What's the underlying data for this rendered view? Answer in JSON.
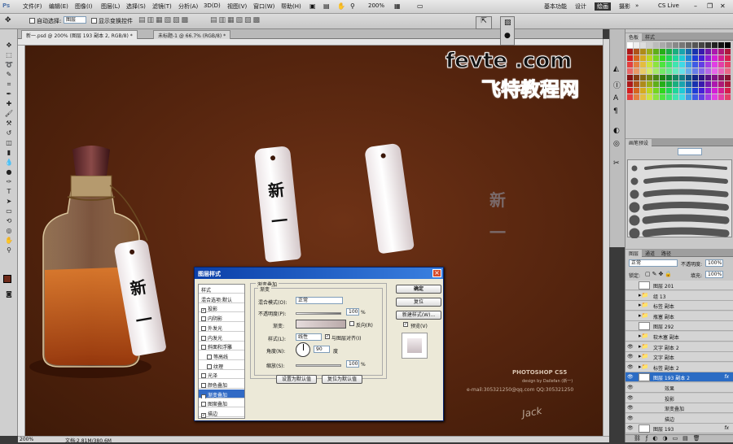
{
  "menu": {
    "logo": "Ps",
    "items": [
      "文件(F)",
      "编辑(E)",
      "图像(I)",
      "图层(L)",
      "选择(S)",
      "滤镜(T)",
      "分析(A)",
      "3D(D)",
      "视图(V)",
      "窗口(W)",
      "帮助(H)"
    ],
    "zoom": "200%",
    "workspace": [
      "基本功能",
      "设计",
      "绘画",
      "摄影"
    ],
    "workspace_active": "绘画",
    "cslive": "CS Live"
  },
  "options": {
    "autoselect": "自动选择:",
    "autoselect_value": "图层",
    "show_transform": "显示变换控件"
  },
  "tabs": [
    {
      "label": "新一.psd @ 200% (图层 193 副本 2, RGB/8) *"
    },
    {
      "label": "未标题-1 @ 66.7% (RGB/8) *"
    }
  ],
  "watermark": {
    "line1": "fevte .com",
    "line2": "飞特教程网"
  },
  "canvas": {
    "tag_char1": "新",
    "tag_char2": "一",
    "credit_title": "PHOTOSHOP CS5",
    "credit_sub": "design by Dailefan (新一)",
    "email": "e-mail:305321250@qq.com  QQ:305321250",
    "signature": "Jack"
  },
  "status": {
    "zoom": "200%",
    "doc": "文档:2.81M/380.6M"
  },
  "panels": {
    "swatches_tabs": [
      "色板",
      "样式"
    ],
    "brush_tab": "画笔预设",
    "layers_tabs": [
      "图层",
      "通道",
      "路径"
    ],
    "blend_mode": "正常",
    "opacity_label": "不透明度:",
    "opacity": "100%",
    "lock_label": "锁定:",
    "fill_label": "填充:",
    "fill": "100%",
    "layers": [
      {
        "name": "图层 201",
        "type": "layer",
        "eye": false
      },
      {
        "name": "组 13",
        "type": "group",
        "eye": false
      },
      {
        "name": "标签 副本",
        "type": "group",
        "eye": false
      },
      {
        "name": "瓶塞 副本",
        "type": "group",
        "eye": false
      },
      {
        "name": "图层 292",
        "type": "layer",
        "eye": false
      },
      {
        "name": "软木塞 副本",
        "type": "group",
        "eye": false
      },
      {
        "name": "文字 副本 2",
        "type": "group",
        "eye": true
      },
      {
        "name": "文字 副本",
        "type": "group",
        "eye": true
      },
      {
        "name": "标签 副本 2",
        "type": "group",
        "eye": true
      },
      {
        "name": "图层 193 副本 2",
        "type": "layer",
        "eye": true,
        "selected": true,
        "fx": "fx"
      },
      {
        "name": "效果",
        "type": "effect",
        "eye": true
      },
      {
        "name": "投影",
        "type": "effect",
        "eye": true
      },
      {
        "name": "渐变叠加",
        "type": "effect",
        "eye": true
      },
      {
        "name": "描边",
        "type": "effect",
        "eye": true
      },
      {
        "name": "图层 193",
        "type": "layer",
        "eye": true,
        "fx": "fx"
      }
    ]
  },
  "dialog": {
    "title": "图层样式",
    "styles": [
      {
        "label": "样式",
        "cb": null
      },
      {
        "label": "混合选项:默认",
        "cb": null
      },
      {
        "label": "投影",
        "cb": true
      },
      {
        "label": "内阴影",
        "cb": false
      },
      {
        "label": "外发光",
        "cb": false
      },
      {
        "label": "内发光",
        "cb": false
      },
      {
        "label": "斜面和浮雕",
        "cb": false
      },
      {
        "label": "等高线",
        "cb": false
      },
      {
        "label": "纹理",
        "cb": false
      },
      {
        "label": "光泽",
        "cb": false
      },
      {
        "label": "颜色叠加",
        "cb": false
      },
      {
        "label": "渐变叠加",
        "cb": true,
        "selected": true
      },
      {
        "label": "图案叠加",
        "cb": false
      },
      {
        "label": "描边",
        "cb": true
      }
    ],
    "group_title": "渐变叠加",
    "sub_title": "渐变",
    "blend_label": "混合模式(O):",
    "blend_value": "正常",
    "opacity_label": "不透明度(P):",
    "opacity": "100",
    "pct": "%",
    "gradient_label": "渐变:",
    "reverse": "反向(R)",
    "style_label": "样式(L):",
    "style_value": "线性",
    "align": "与图层对齐(I)",
    "angle_label": "角度(N):",
    "angle": "90",
    "deg": "度",
    "scale_label": "缩放(S):",
    "scale": "100",
    "default_btn": "设置为默认值",
    "reset_btn": "复位为默认值",
    "ok": "确定",
    "cancel": "复位",
    "new_style": "新建样式(W)...",
    "preview": "预览(V)"
  }
}
